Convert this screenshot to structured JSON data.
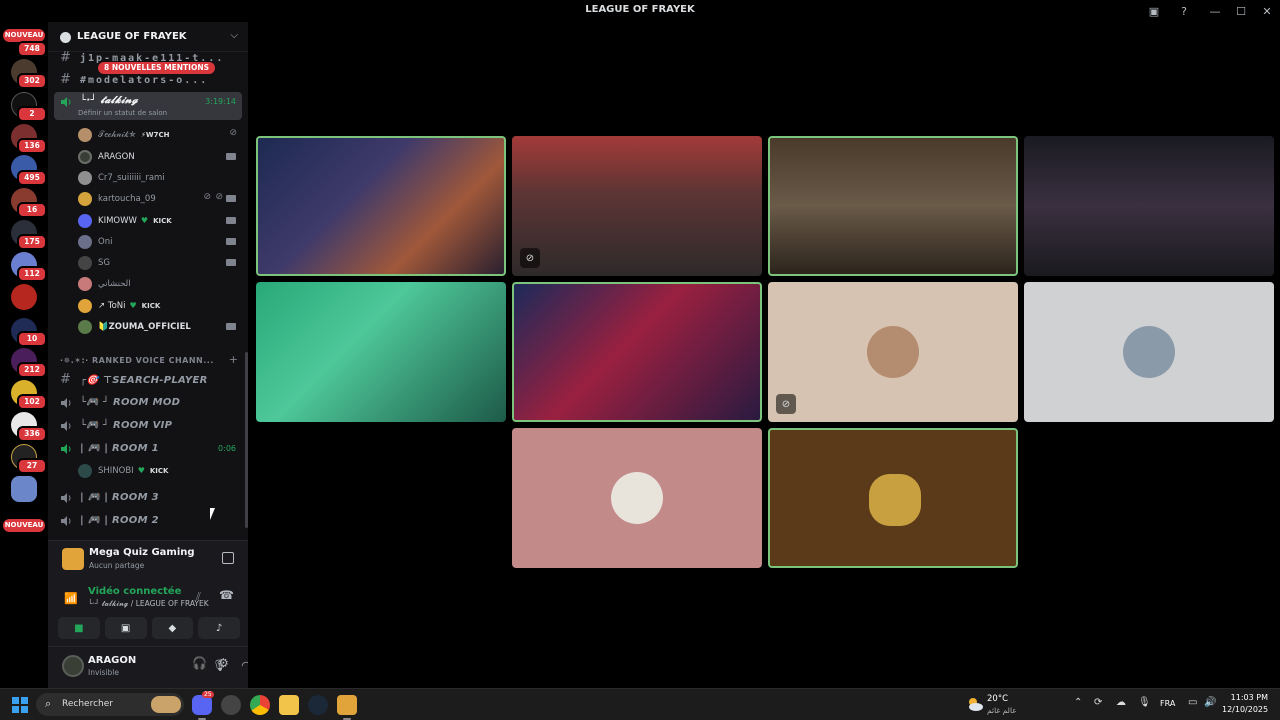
{
  "window": {
    "title": "LEAGUE OF FRAYEK"
  },
  "rail": {
    "nouveau_top": "NOUVEAU",
    "nouveau_bottom": "NOUVEAU",
    "badges": [
      "748",
      "302",
      "2",
      "136",
      "495",
      "16",
      "175",
      "112",
      "10",
      "212",
      "102",
      "336",
      "27"
    ]
  },
  "guild": {
    "name": "LEAGUE OF FRAYEK",
    "mention_pill": "8 NOUVELLES MENTIONS",
    "text_channels": [
      "j1p-maak-e111-t...",
      "#modelators-o..."
    ],
    "active_voice": {
      "name": "└·┘ 𝓽𝓪𝓵𝓴𝓲𝓷𝓰",
      "time": "3:19:14",
      "status_hint": "Définir un statut de salon"
    },
    "voice_users": [
      {
        "name": "𝒯𝑒𝒸𝒽𝓃𝒾𝓀✯",
        "tag": "⚡W7CH"
      },
      {
        "name": "ARAGON",
        "tag": ""
      },
      {
        "name": "Cr7_suiiiiii_rami",
        "tag": ""
      },
      {
        "name": "kartoucha_09",
        "tag": ""
      },
      {
        "name": "KIMOWW",
        "tag": "KICK"
      },
      {
        "name": "Oni",
        "tag": ""
      },
      {
        "name": "SG",
        "tag": ""
      },
      {
        "name": "الحنشاني",
        "tag": ""
      },
      {
        "name": "↗ ToNi",
        "tag": "KICK"
      },
      {
        "name": "🔰ZOUMA_OFFICIEL",
        "tag": ""
      }
    ],
    "category": "·✵.✶:· RANKED VOICE CHANN...",
    "ranked_channels": [
      {
        "name": "┌🎯 ⊤SEARCH-PLAYER",
        "type": "text",
        "time": ""
      },
      {
        "name": "└🎮 ┘ ROOM MOD",
        "type": "voice",
        "time": ""
      },
      {
        "name": "└🎮 ┘ ROOM VIP",
        "type": "voice",
        "time": ""
      },
      {
        "name": "| 🎮 | ROOM 1",
        "type": "voice",
        "time": "0:06"
      },
      {
        "name": "| 🎮 | ROOM 3",
        "type": "voice",
        "time": ""
      },
      {
        "name": "| 🎮 | ROOM 2",
        "type": "voice",
        "time": ""
      }
    ],
    "room1_user": {
      "name": "SHINOBI",
      "tag": "KICK"
    }
  },
  "activity": {
    "title": "Mega Quiz Gaming",
    "subtitle": "Aucun partage"
  },
  "voice_panel": {
    "status": "Vidéo connectée",
    "channel": "└·┘ 𝓽𝓪𝓵𝓴𝓲𝓷𝓰 / LEAGUE OF FRAYEK"
  },
  "user": {
    "name": "ARAGON",
    "status": "Invisible"
  },
  "taskbar": {
    "search_placeholder": "Rechercher",
    "discord_badge": "25",
    "weather_temp": "20°C",
    "weather_desc": "عالم غائم",
    "lang": "FRA",
    "time": "11:03 PM",
    "date": "12/10/2025"
  },
  "colors": {
    "accent_green": "#23a55a",
    "badge_red": "#da373c",
    "speaking_border": "#7cc47c"
  }
}
